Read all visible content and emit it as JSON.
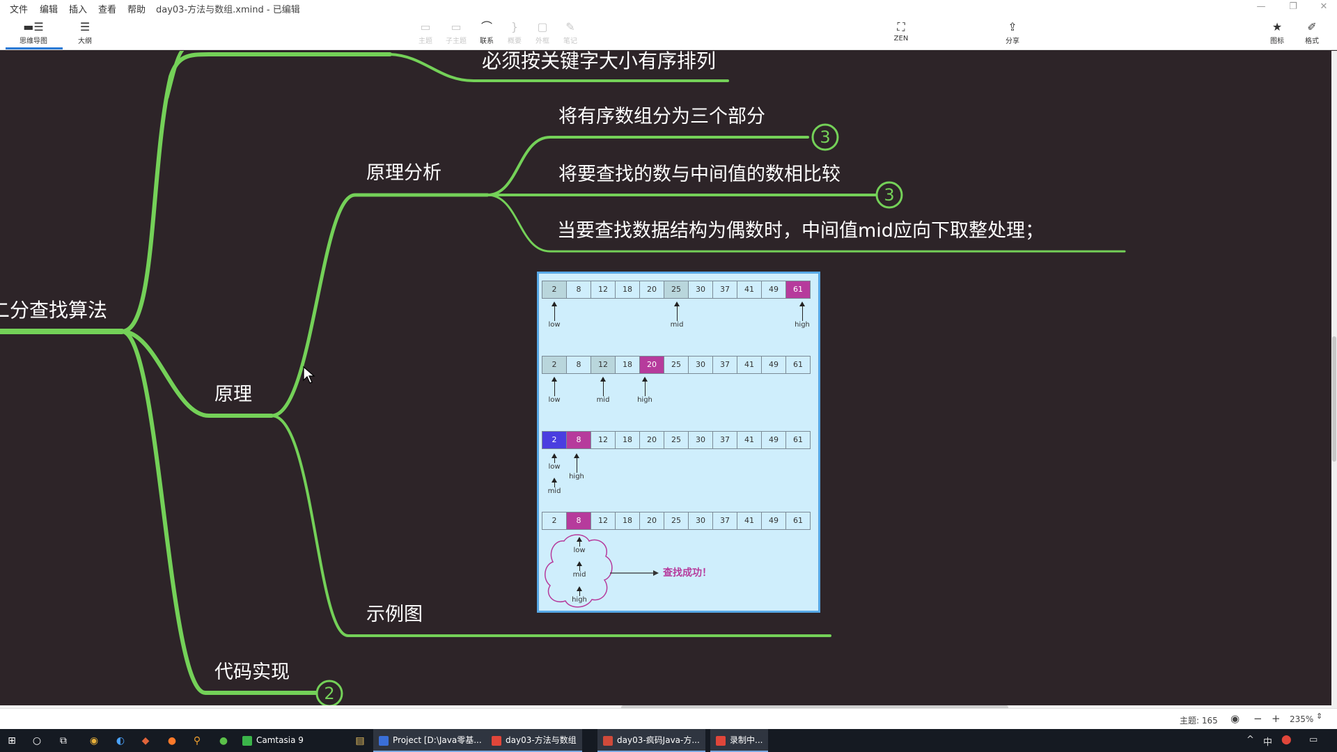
{
  "window": {
    "title": "day03-方法与数组.xmind - 已编辑",
    "menu": [
      "文件",
      "编辑",
      "插入",
      "查看",
      "帮助"
    ],
    "controls": [
      "—",
      "❐",
      "✕"
    ]
  },
  "toolbar": {
    "left": [
      {
        "label": "思维导图",
        "icon": "mindmap-icon"
      },
      {
        "label": "大纲",
        "icon": "outline-icon"
      }
    ],
    "center": [
      {
        "label": "主题",
        "icon": "topic-icon",
        "disabled": true
      },
      {
        "label": "子主题",
        "icon": "subtopic-icon",
        "disabled": true
      },
      {
        "label": "联系",
        "icon": "relationship-icon",
        "disabled": false
      },
      {
        "label": "概要",
        "icon": "summary-icon",
        "disabled": true
      },
      {
        "label": "外框",
        "icon": "boundary-icon",
        "disabled": true
      },
      {
        "label": "笔记",
        "icon": "note-icon",
        "disabled": true
      }
    ],
    "zen": "ZEN",
    "share": "分享",
    "right": [
      {
        "label": "图标",
        "icon": "star-icon"
      },
      {
        "label": "格式",
        "icon": "format-brush-icon"
      }
    ]
  },
  "mindmap": {
    "root": "二分查找算法",
    "top_cut_node": "必须按关键字大小有序排列",
    "principle": "原理",
    "analysis": "原理分析",
    "analysis_children": [
      {
        "text": "将有序数组分为三个部分",
        "badge": "3"
      },
      {
        "text": "将要查找的数与中间值的数相比较",
        "badge": "3"
      },
      {
        "text": "当要查找数据结构为偶数时，中间值mid应向下取整处理；",
        "badge": ""
      }
    ],
    "example": "示例图",
    "code": "代码实现",
    "code_badge": "2",
    "line_color": "#74d158"
  },
  "example_image": {
    "values": [
      "2",
      "8",
      "12",
      "18",
      "20",
      "25",
      "30",
      "37",
      "41",
      "49",
      "61"
    ],
    "labels": {
      "low": "low",
      "mid": "mid",
      "high": "high"
    },
    "result": "查找成功！",
    "colors": {
      "highlight": "#b63b9c",
      "low_mid": "#4a3ee0",
      "visited": "#b9d6dc",
      "bg": "#cfeefc"
    }
  },
  "status": {
    "topics": "主题: 165",
    "zoom": "235%"
  },
  "taskbar": {
    "apps": [
      {
        "label": "Camtasia 9",
        "color": "#3bb54a"
      },
      {
        "label": "Project [D:\\Java零基...",
        "color": "#3a6fd8"
      },
      {
        "label": "day03-方法与数组",
        "color": "#e0463a"
      },
      {
        "label": "day03-疯码Java-方...",
        "color": "#d04a3a"
      },
      {
        "label": "录制中...",
        "color": "#e0463a"
      }
    ],
    "tray": [
      "^",
      "中"
    ]
  }
}
